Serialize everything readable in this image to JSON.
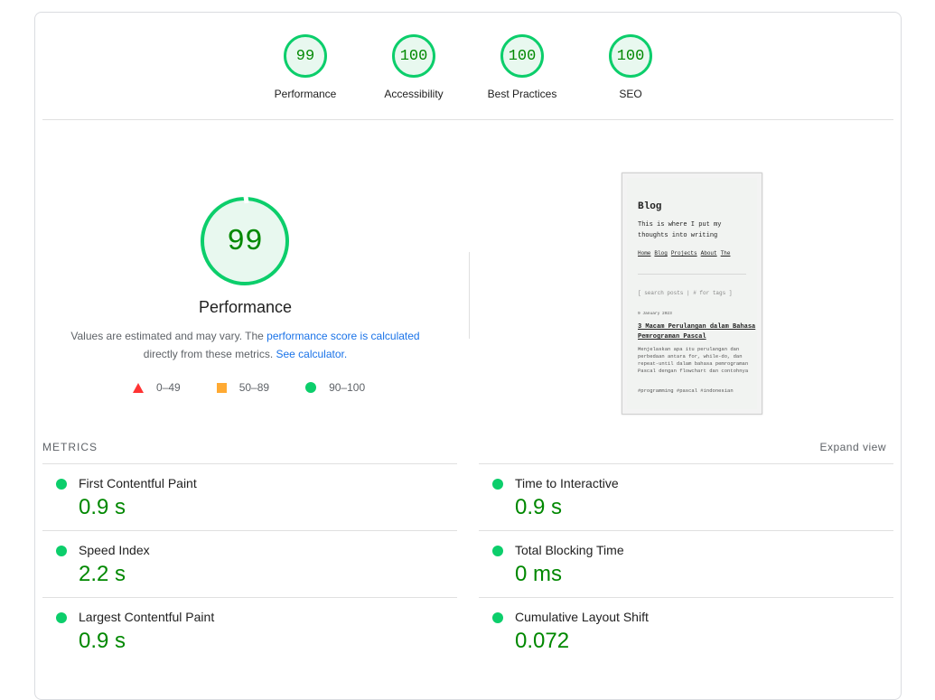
{
  "categories": [
    {
      "score": "99",
      "label": "Performance"
    },
    {
      "score": "100",
      "label": "Accessibility"
    },
    {
      "score": "100",
      "label": "Best Practices"
    },
    {
      "score": "100",
      "label": "SEO"
    }
  ],
  "performance": {
    "score": "99",
    "title": "Performance",
    "note_prefix": "Values are estimated and may vary. The ",
    "note_link": "performance score is calculated",
    "note_middle": "directly from these metrics. ",
    "calculator_link": "See calculator.",
    "legend": [
      "0–49",
      "50–89",
      "90–100"
    ]
  },
  "screenshot": {
    "title": "Blog",
    "desc": "This is where I put my thoughts into writing",
    "nav": [
      "Home",
      "Blog",
      "Projects",
      "About",
      "The"
    ],
    "search": "[ search posts | # for tags  ]",
    "date": "9 January 2023",
    "post_title": "3 Macam Perulangan dalam Bahasa Pemrograman Pascal",
    "post_body": "Menjelaskan apa itu perulangan dan perbedaan antara for, while-do, dan repeat-until dalam bahasa pemrograman Pascal dengan flowchart dan contohnya",
    "tags": "#programming #pascal #indonesian"
  },
  "metrics": {
    "header": "METRICS",
    "expand_label": "Expand view",
    "left": [
      {
        "name": "First Contentful Paint",
        "value": "0.9 s"
      },
      {
        "name": "Speed Index",
        "value": "2.2 s"
      },
      {
        "name": "Largest Contentful Paint",
        "value": "0.9 s"
      }
    ],
    "right": [
      {
        "name": "Time to Interactive",
        "value": "0.9 s"
      },
      {
        "name": "Total Blocking Time",
        "value": "0 ms"
      },
      {
        "name": "Cumulative Layout Shift",
        "value": "0.072"
      }
    ]
  },
  "colors": {
    "pass": "#0cce6b",
    "pass_text": "#008800",
    "average": "#ffaa33",
    "fail": "#ff3333",
    "link": "#1a73e8"
  }
}
